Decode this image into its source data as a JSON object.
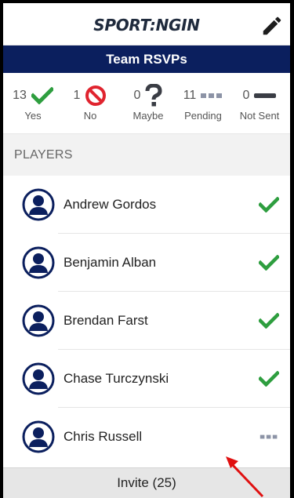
{
  "app": {
    "logo_text": "SPORT:NGIN"
  },
  "title": "Team RSVPs",
  "summary": [
    {
      "count": "13",
      "label": "Yes",
      "icon": "check-icon",
      "color": "#2e9e3f"
    },
    {
      "count": "1",
      "label": "No",
      "icon": "no-icon",
      "color": "#e0242f"
    },
    {
      "count": "0",
      "label": "Maybe",
      "icon": "question-icon",
      "color": "#3a3d45"
    },
    {
      "count": "11",
      "label": "Pending",
      "icon": "dots-icon",
      "color": "#8c93a6"
    },
    {
      "count": "0",
      "label": "Not Sent",
      "icon": "dash-icon",
      "color": "#3a3d45"
    }
  ],
  "section_title": "PLAYERS",
  "players": [
    {
      "name": "Andrew  Gordos",
      "status": "yes"
    },
    {
      "name": "Benjamin Alban",
      "status": "yes"
    },
    {
      "name": "Brendan Farst",
      "status": "yes"
    },
    {
      "name": "Chase Turczynski",
      "status": "yes"
    },
    {
      "name": "Chris Russell",
      "status": "pending"
    }
  ],
  "invite_label": "Invite (25)",
  "colors": {
    "navy": "#0b1f5e",
    "green": "#2e9e3f",
    "red": "#e0242f",
    "annotation": "#e01010"
  }
}
